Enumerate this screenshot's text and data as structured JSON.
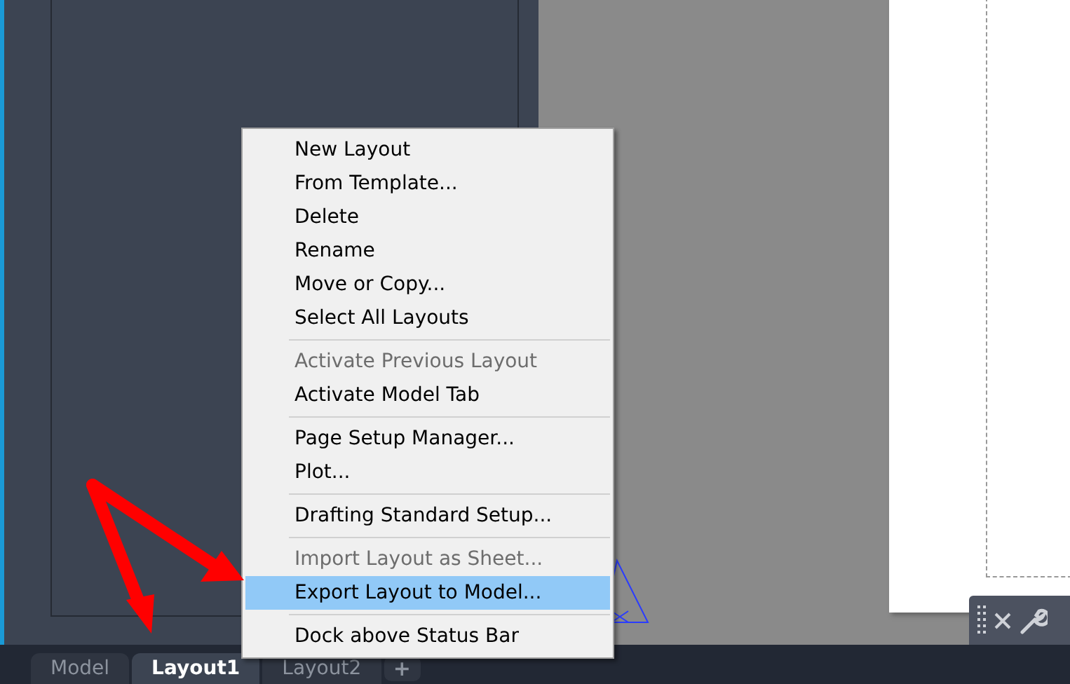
{
  "context_menu": {
    "groups": [
      [
        {
          "label": "New Layout",
          "disabled": false,
          "selected": false
        },
        {
          "label": "From Template...",
          "disabled": false,
          "selected": false
        },
        {
          "label": "Delete",
          "disabled": false,
          "selected": false
        },
        {
          "label": "Rename",
          "disabled": false,
          "selected": false
        },
        {
          "label": "Move or Copy...",
          "disabled": false,
          "selected": false
        },
        {
          "label": "Select All Layouts",
          "disabled": false,
          "selected": false
        }
      ],
      [
        {
          "label": "Activate Previous Layout",
          "disabled": true,
          "selected": false
        },
        {
          "label": "Activate Model Tab",
          "disabled": false,
          "selected": false
        }
      ],
      [
        {
          "label": "Page Setup Manager...",
          "disabled": false,
          "selected": false
        },
        {
          "label": "Plot...",
          "disabled": false,
          "selected": false
        }
      ],
      [
        {
          "label": "Drafting Standard Setup...",
          "disabled": false,
          "selected": false
        }
      ],
      [
        {
          "label": "Import Layout as Sheet...",
          "disabled": true,
          "selected": false
        },
        {
          "label": "Export Layout to Model...",
          "disabled": false,
          "selected": true
        }
      ],
      [
        {
          "label": "Dock above Status Bar",
          "disabled": false,
          "selected": false
        }
      ]
    ]
  },
  "layout_tabs": [
    {
      "label": "Model",
      "selected": false
    },
    {
      "label": "Layout1",
      "selected": true
    },
    {
      "label": "Layout2",
      "selected": false
    }
  ],
  "add_tab": {
    "label": "+"
  }
}
